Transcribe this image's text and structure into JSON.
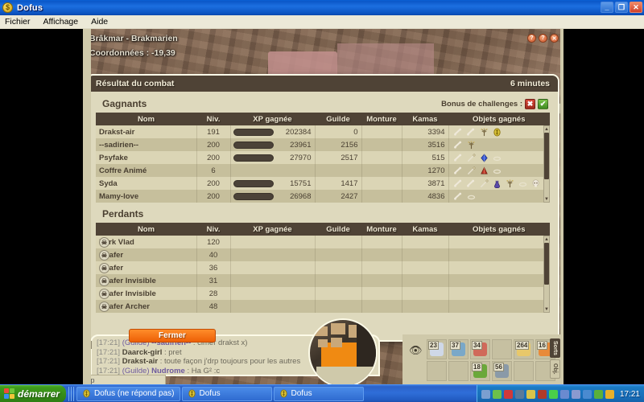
{
  "window": {
    "title": "Dofus",
    "icon": "dofus-coin-icon",
    "minimize": "_",
    "maximize": "❐",
    "close": "✕",
    "menu": [
      "Fichier",
      "Affichage",
      "Aide"
    ]
  },
  "game": {
    "location_name": "Brâkmar - Brakmarien",
    "coordinates_label": "Coordonnées : -19,39",
    "map_controls": [
      "?",
      "?",
      "✕"
    ],
    "map_arrow": "◄"
  },
  "combat_panel": {
    "title": "Résultat du combat",
    "duration": "6 minutes",
    "winners_title": "Gagnants",
    "losers_title": "Perdants",
    "bonus_label": "Bonus de challenges :",
    "challenge_fail": "✖",
    "challenge_pass": "✔",
    "columns": [
      "Nom",
      "Niv.",
      "XP gagnée",
      "Guilde",
      "Monture",
      "Kamas",
      "Objets gagnés"
    ],
    "winners": [
      {
        "nom": "Drakst-air",
        "niv": "191",
        "xp_pct": 88,
        "xp": "202384",
        "guilde": "0",
        "monture": "",
        "kamas": "3394",
        "objets": [
          "bone-icon",
          "bone-icon",
          "plant-icon",
          "coin-icon"
        ]
      },
      {
        "nom": "--sadirien--",
        "niv": "200",
        "xp_pct": 14,
        "xp": "23961",
        "guilde": "2156",
        "monture": "",
        "kamas": "3516",
        "objets": [
          "bone-icon",
          "plant-icon"
        ]
      },
      {
        "nom": "Psyfake",
        "niv": "200",
        "xp_pct": 14,
        "xp": "27970",
        "guilde": "2517",
        "monture": "",
        "kamas": "515",
        "objets": [
          "bone-icon",
          "wand-icon",
          "blue-gem-icon",
          "ring-icon"
        ]
      },
      {
        "nom": "Coffre Animé",
        "niv": "6",
        "xp_pct": 0,
        "xp": "",
        "guilde": "",
        "monture": "",
        "kamas": "1270",
        "objets": [
          "bone-icon",
          "wand-icon",
          "red-gem-icon",
          "ring-icon"
        ]
      },
      {
        "nom": "Syda",
        "niv": "200",
        "xp_pct": 14,
        "xp": "15751",
        "guilde": "1417",
        "monture": "",
        "kamas": "3871",
        "objets": [
          "bone-icon",
          "bone-icon",
          "wand-icon",
          "potion-icon",
          "plant-icon",
          "ring-icon",
          "skull-icon"
        ]
      },
      {
        "nom": "Mamy-love",
        "niv": "200",
        "xp_pct": 14,
        "xp": "26968",
        "guilde": "2427",
        "monture": "",
        "kamas": "4836",
        "objets": [
          "bone-icon",
          "ring-icon"
        ]
      }
    ],
    "losers": [
      {
        "nom": "Dark Vlad",
        "niv": "120",
        "xp": "",
        "guilde": "",
        "monture": "",
        "kamas": "",
        "objets": []
      },
      {
        "nom": "Chafer",
        "niv": "40",
        "xp": "",
        "guilde": "",
        "monture": "",
        "kamas": "",
        "objets": []
      },
      {
        "nom": "Chafer",
        "niv": "36",
        "xp": "",
        "guilde": "",
        "monture": "",
        "kamas": "",
        "objets": []
      },
      {
        "nom": "Chafer Invisible",
        "niv": "31",
        "xp": "",
        "guilde": "",
        "monture": "",
        "kamas": "",
        "objets": []
      },
      {
        "nom": "Chafer Invisible",
        "niv": "28",
        "xp": "",
        "guilde": "",
        "monture": "",
        "kamas": "",
        "objets": []
      },
      {
        "nom": "Chafer Archer",
        "niv": "48",
        "xp": "",
        "guilde": "",
        "monture": "",
        "kamas": "",
        "objets": []
      }
    ],
    "close_button": "Fermer"
  },
  "chat": {
    "lines": [
      {
        "ts": "[17:21]",
        "channel": "(Guilde)",
        "name": "--sadirien--",
        "sep": " : ",
        "msg": "cimer drakst x)"
      },
      {
        "ts": "[17:21]",
        "channel": "",
        "name": "Daarck-girl",
        "sep": " : ",
        "msg": "pret"
      },
      {
        "ts": "[17:21]",
        "channel": "",
        "name": "Drakst-air",
        "sep": " : ",
        "msg": "toute façon j'drp toujours pour les autres"
      },
      {
        "ts": "[17:21]",
        "channel": "(Guilde)",
        "name": "Nudrome",
        "sep": " : ",
        "msg": "Ha G² :c"
      }
    ],
    "input_value": "/p"
  },
  "hud": {
    "eye_icon": "eye-icon",
    "slots_row1": [
      "23",
      "37",
      "34",
      "",
      "264",
      "16"
    ],
    "slots_row2": [
      "",
      "",
      "18",
      "56",
      "",
      ""
    ],
    "tab_sorts": "Sorts",
    "tab_obj": "Obj."
  },
  "taskbar": {
    "start_label": "démarrer",
    "tasks": [
      {
        "label": "Dofus  (ne répond pas)"
      },
      {
        "label": "Dofus"
      },
      {
        "label": "Dofus"
      }
    ],
    "clock": "17:21"
  },
  "colors": {
    "accent_orange": "#ef6a10",
    "panel_bg": "#ded9bd",
    "header_brown": "#4f4336",
    "taskbar_blue": "#2f6ed9",
    "start_green": "#3f9e1c"
  }
}
